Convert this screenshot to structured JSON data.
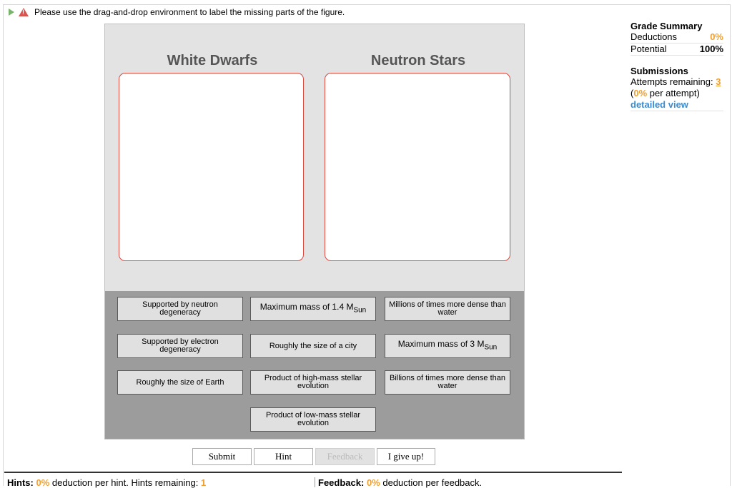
{
  "instruction": "Please use the drag-and-drop environment to label the missing parts of the figure.",
  "figure": {
    "zones": [
      {
        "title": "White Dwarfs"
      },
      {
        "title": "Neutron Stars"
      }
    ],
    "labels": [
      "Supported by neutron degeneracy",
      "Maximum mass of 1.4 M",
      "Millions of times more dense than water",
      "Supported by electron degeneracy",
      "Roughly the size of a city",
      "Maximum mass of 3 M",
      "Roughly the size of Earth",
      "Product of high-mass stellar evolution",
      "Billions of times more dense than water",
      "Product of low-mass stellar evolution"
    ],
    "sun_subscript": "Sun"
  },
  "buttons": {
    "submit": "Submit",
    "hint": "Hint",
    "feedback": "Feedback",
    "give_up": "I give up!"
  },
  "hints_bar": {
    "hints_label": "Hints:",
    "hints_pct": "0%",
    "hints_text": "deduction per hint. Hints remaining:",
    "hints_remaining": "1",
    "feedback_label": "Feedback:",
    "feedback_pct": "0%",
    "feedback_text": "deduction per feedback."
  },
  "grade_summary": {
    "title": "Grade Summary",
    "deductions_label": "Deductions",
    "deductions_value": "0%",
    "potential_label": "Potential",
    "potential_value": "100%",
    "submissions_title": "Submissions",
    "attempts_label": "Attempts remaining:",
    "attempts_value": "3",
    "per_attempt_pct": "0%",
    "per_attempt_text": "per attempt)",
    "detailed_view": "detailed view"
  },
  "colors": {
    "accent_orange": "#f0a030",
    "link_blue": "#3a8bd0",
    "drop_border": "#d9473d"
  }
}
